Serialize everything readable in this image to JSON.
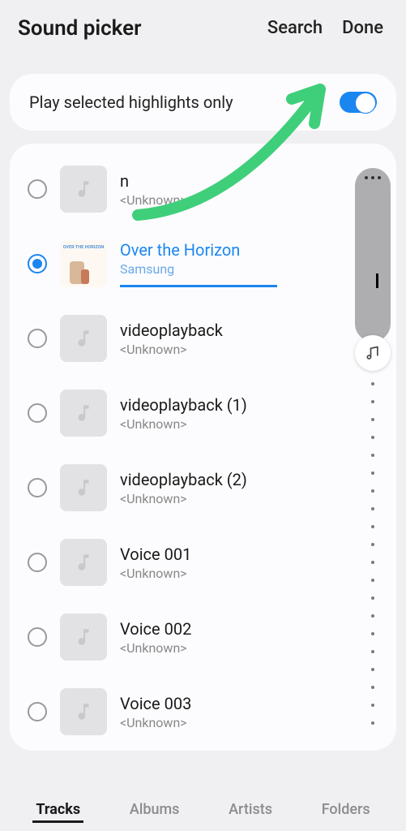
{
  "header": {
    "title": "Sound picker",
    "search_label": "Search",
    "done_label": "Done"
  },
  "highlights": {
    "label": "Play selected highlights only",
    "enabled": true
  },
  "tracks": [
    {
      "title": "n",
      "artist": "<Unknown>",
      "selected": false,
      "has_image": false
    },
    {
      "title": "Over the Horizon",
      "artist": "Samsung",
      "selected": true,
      "has_image": true,
      "playing_progress": 0.6
    },
    {
      "title": "videoplayback",
      "artist": "<Unknown>",
      "selected": false,
      "has_image": false
    },
    {
      "title": "videoplayback (1)",
      "artist": "<Unknown>",
      "selected": false,
      "has_image": false
    },
    {
      "title": "videoplayback (2)",
      "artist": "<Unknown>",
      "selected": false,
      "has_image": false
    },
    {
      "title": "Voice 001",
      "artist": "<Unknown>",
      "selected": false,
      "has_image": false
    },
    {
      "title": "Voice 002",
      "artist": "<Unknown>",
      "selected": false,
      "has_image": false
    },
    {
      "title": "Voice 003",
      "artist": "<Unknown>",
      "selected": false,
      "has_image": false
    }
  ],
  "tabs": [
    {
      "label": "Tracks",
      "active": true
    },
    {
      "label": "Albums",
      "active": false
    },
    {
      "label": "Artists",
      "active": false
    },
    {
      "label": "Folders",
      "active": false
    }
  ]
}
